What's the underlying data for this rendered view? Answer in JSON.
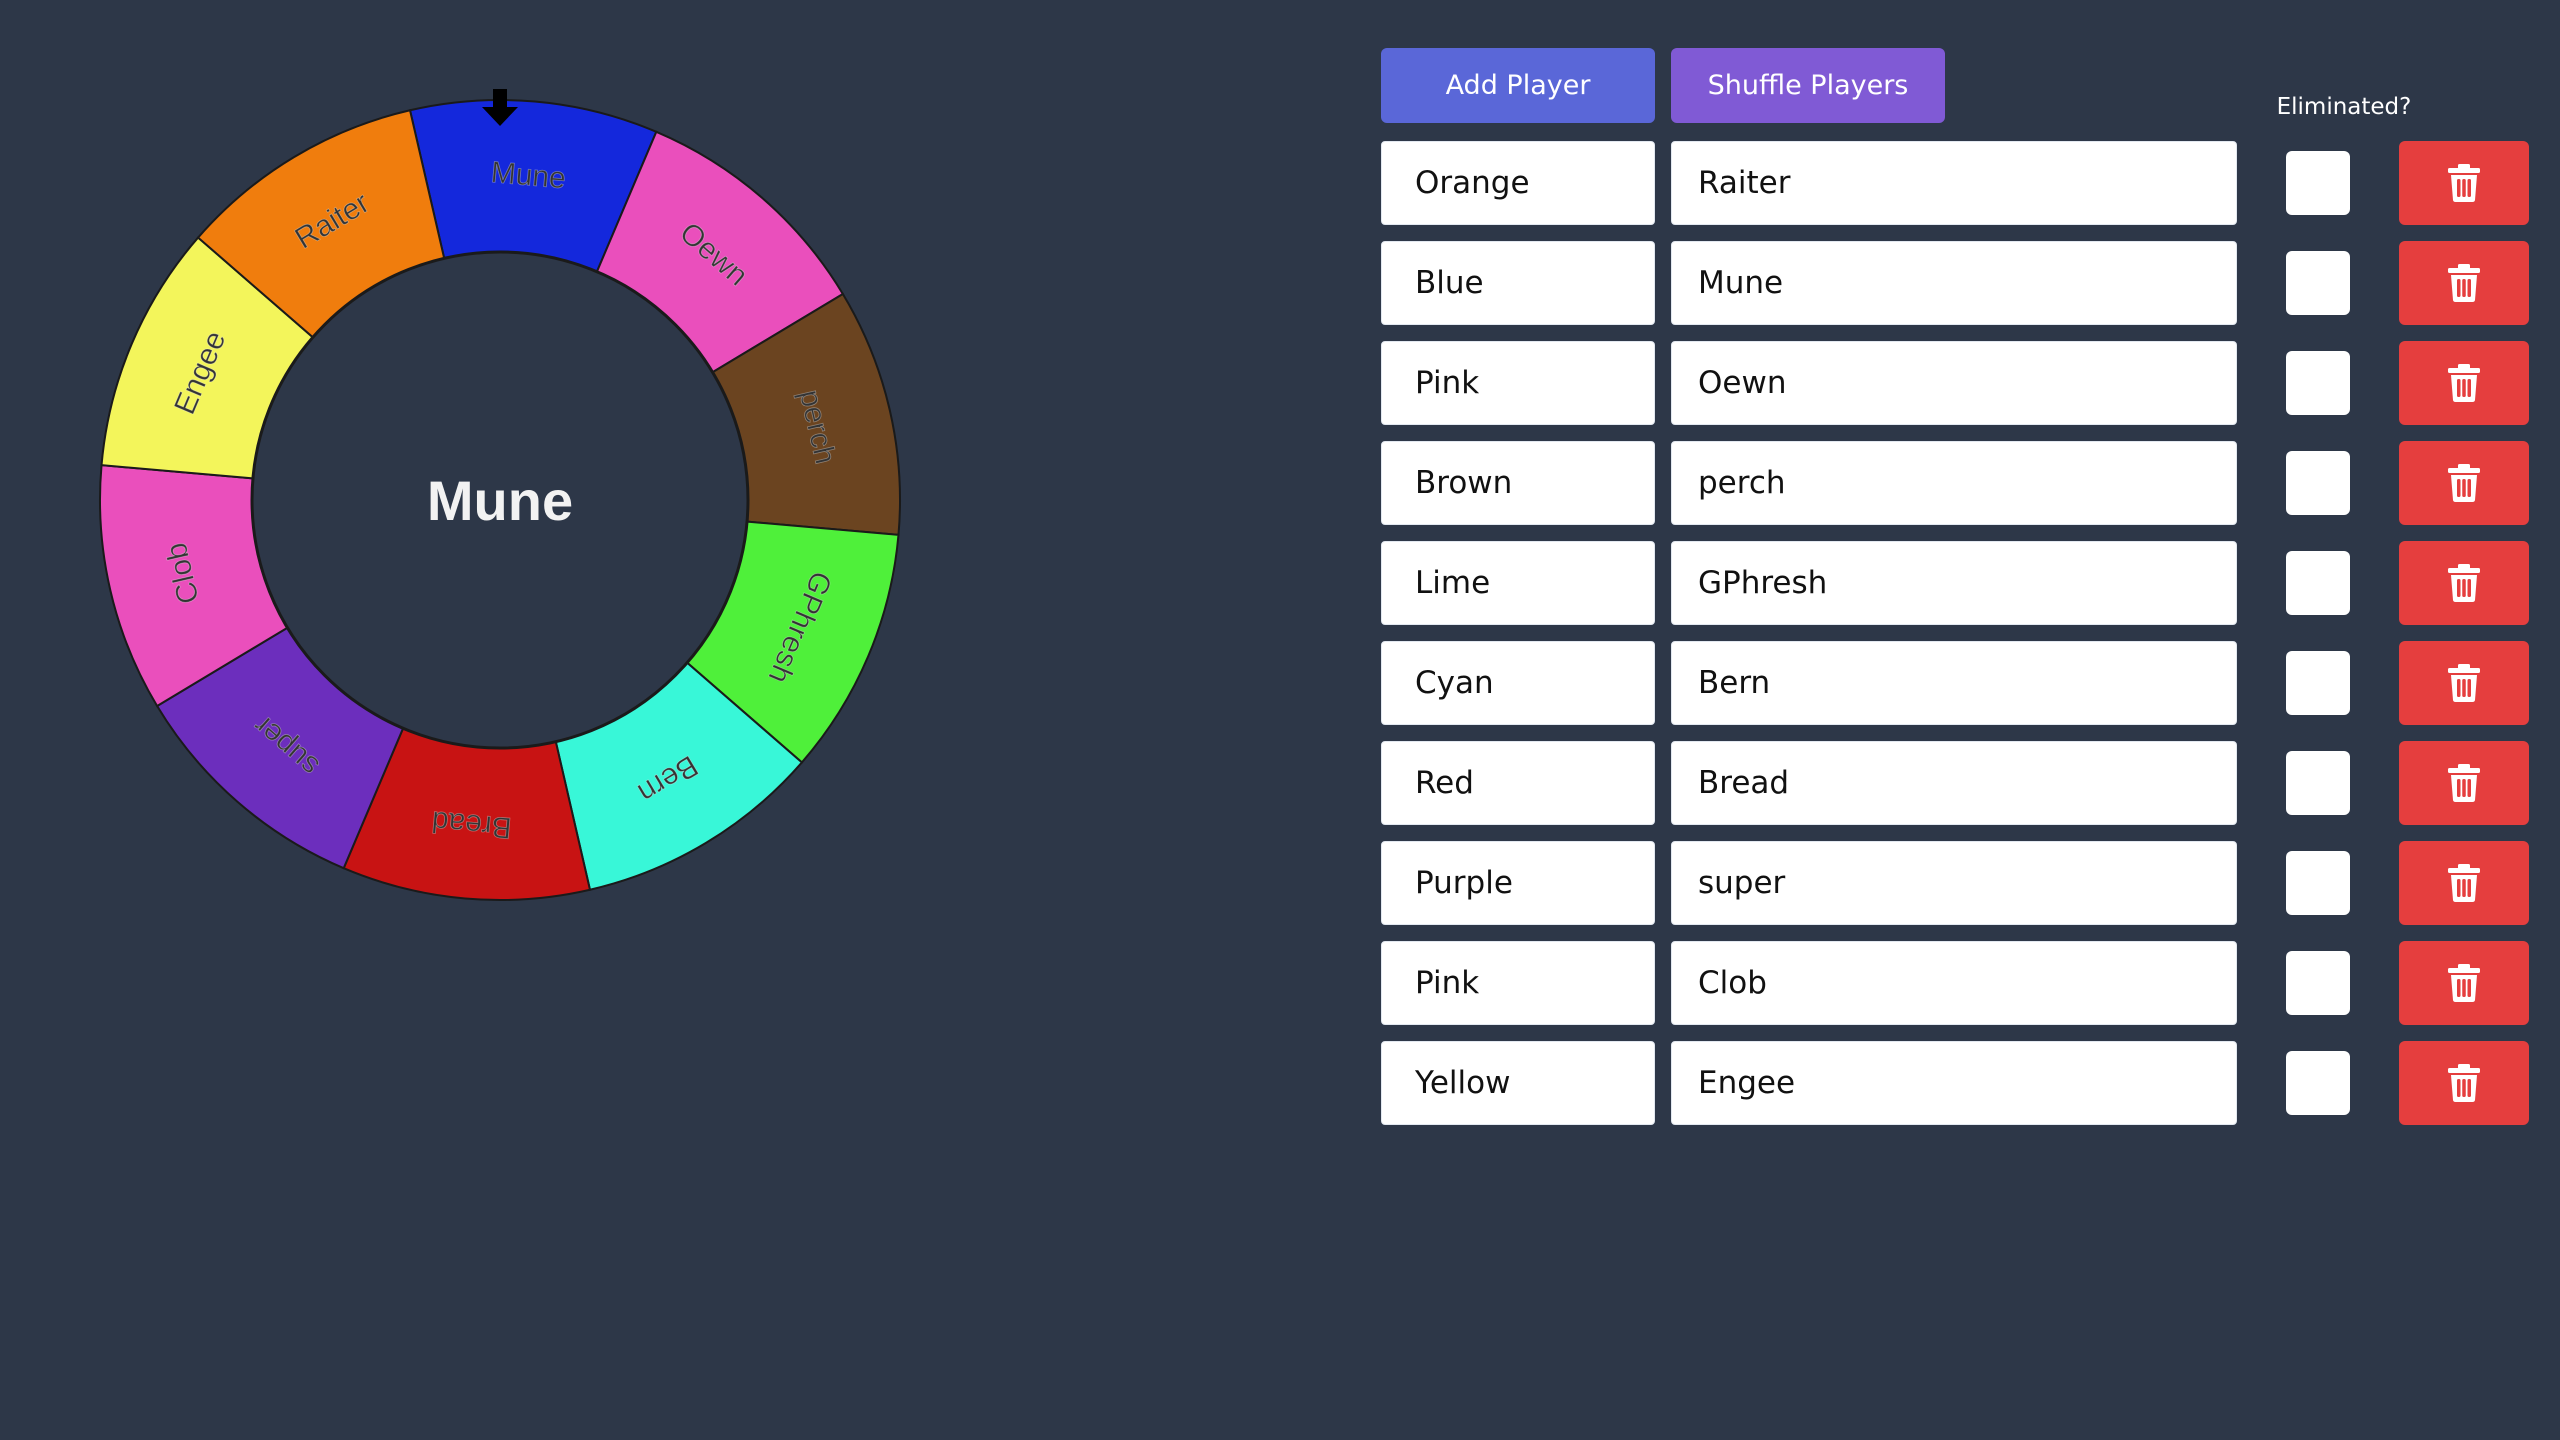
{
  "wheel": {
    "selected": "Mune",
    "pointer_icon": "down-arrow-icon",
    "segments": [
      {
        "label": "Mune",
        "color": "#1428dc"
      },
      {
        "label": "Oewn",
        "color": "#ea4fbc"
      },
      {
        "label": "perch",
        "color": "#6b4420"
      },
      {
        "label": "GPhresh",
        "color": "#4ff03a"
      },
      {
        "label": "Bern",
        "color": "#38f7d8"
      },
      {
        "label": "Bread",
        "color": "#c81313"
      },
      {
        "label": "super",
        "color": "#6c2ebd"
      },
      {
        "label": "Clob",
        "color": "#ea4fbc"
      },
      {
        "label": "Engee",
        "color": "#f3f55b"
      },
      {
        "label": "Raiter",
        "color": "#f07d0d"
      }
    ]
  },
  "controls": {
    "add_player_label": "Add Player",
    "shuffle_players_label": "Shuffle Players",
    "eliminated_header": "Eliminated?",
    "delete_icon": "trash-icon"
  },
  "players": [
    {
      "color": "Orange",
      "name": "Raiter",
      "eliminated": false
    },
    {
      "color": "Blue",
      "name": "Mune",
      "eliminated": false
    },
    {
      "color": "Pink",
      "name": "Oewn",
      "eliminated": false
    },
    {
      "color": "Brown",
      "name": "perch",
      "eliminated": false
    },
    {
      "color": "Lime",
      "name": "GPhresh",
      "eliminated": false
    },
    {
      "color": "Cyan",
      "name": "Bern",
      "eliminated": false
    },
    {
      "color": "Red",
      "name": "Bread",
      "eliminated": false
    },
    {
      "color": "Purple",
      "name": "super",
      "eliminated": false
    },
    {
      "color": "Pink",
      "name": "Clob",
      "eliminated": false
    },
    {
      "color": "Yellow",
      "name": "Engee",
      "eliminated": false
    }
  ]
}
